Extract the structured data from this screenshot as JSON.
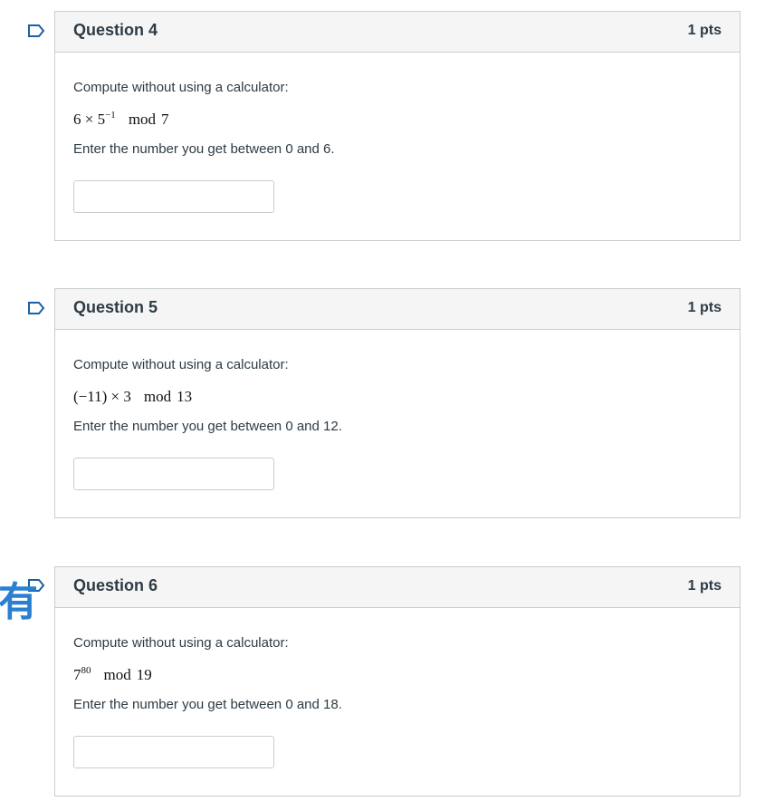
{
  "questions": [
    {
      "title": "Question 4",
      "points": "1 pts",
      "prompt": "Compute without using a calculator:",
      "math": {
        "base": "6 × 5",
        "exp": "−1",
        "mod": "mod",
        "modulus": "7"
      },
      "instruction": "Enter the number you get between 0 and 6.",
      "answer_value": ""
    },
    {
      "title": "Question 5",
      "points": "1 pts",
      "prompt": "Compute without using a calculator:",
      "math": {
        "base": "(−11) × 3",
        "exp": "",
        "mod": "mod",
        "modulus": "13"
      },
      "instruction": "Enter the number you get between 0 and 12.",
      "answer_value": ""
    },
    {
      "title": "Question 6",
      "points": "1 pts",
      "prompt": "Compute without using a calculator:",
      "math": {
        "base": "7",
        "exp": "80",
        "mod": "mod",
        "modulus": "19"
      },
      "instruction": "Enter the number you get between 0 and 18.",
      "answer_value": ""
    }
  ],
  "overlay_glyph": "有",
  "colors": {
    "flag_stroke": "#1a5fa8",
    "overlay_glyph": "#2a7fd0",
    "header_bg": "#f5f5f5",
    "border": "#c7cdd1"
  }
}
